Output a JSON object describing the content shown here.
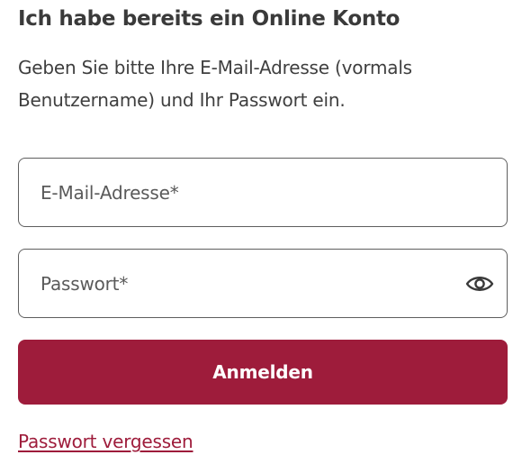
{
  "login": {
    "title": "Ich habe bereits ein Online Konto",
    "intro": "Geben Sie bitte Ihre E-Mail-Adresse (vormals Benutzername) und Ihr Passwort ein.",
    "email": {
      "placeholder": "E-Mail-Adresse*",
      "value": ""
    },
    "password": {
      "placeholder": "Passwort*",
      "value": "",
      "toggle_icon": "eye-icon"
    },
    "submit_label": "Anmelden",
    "forgot_label": "Passwort vergessen"
  },
  "colors": {
    "accent": "#9e1c3b",
    "text": "#3a3a3a",
    "border": "#5f5f5f",
    "background": "#ffffff"
  }
}
